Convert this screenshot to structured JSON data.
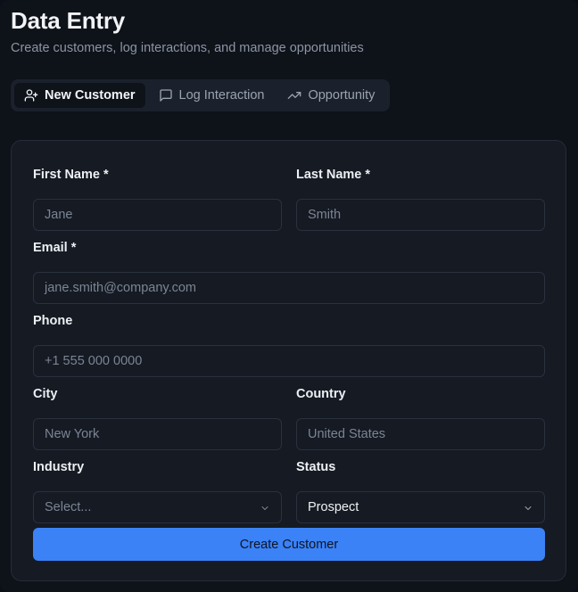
{
  "header": {
    "title": "Data Entry",
    "subtitle": "Create customers, log interactions, and manage opportunities"
  },
  "tabs": [
    {
      "label": "New Customer",
      "icon": "user-plus-icon",
      "active": true
    },
    {
      "label": "Log Interaction",
      "icon": "message-square-icon",
      "active": false
    },
    {
      "label": "Opportunity",
      "icon": "trending-up-icon",
      "active": false
    }
  ],
  "form": {
    "first_name": {
      "label": "First Name *",
      "placeholder": "Jane"
    },
    "last_name": {
      "label": "Last Name *",
      "placeholder": "Smith"
    },
    "email": {
      "label": "Email *",
      "placeholder": "jane.smith@company.com"
    },
    "phone": {
      "label": "Phone",
      "placeholder": "+1 555 000 0000"
    },
    "city": {
      "label": "City",
      "placeholder": "New York"
    },
    "country": {
      "label": "Country",
      "placeholder": "United States"
    },
    "industry": {
      "label": "Industry",
      "placeholder": "Select..."
    },
    "status": {
      "label": "Status",
      "value": "Prospect"
    },
    "submit_label": "Create Customer"
  },
  "colors": {
    "accent": "#3b82f6",
    "background": "#0e1219",
    "card": "#151a23"
  }
}
